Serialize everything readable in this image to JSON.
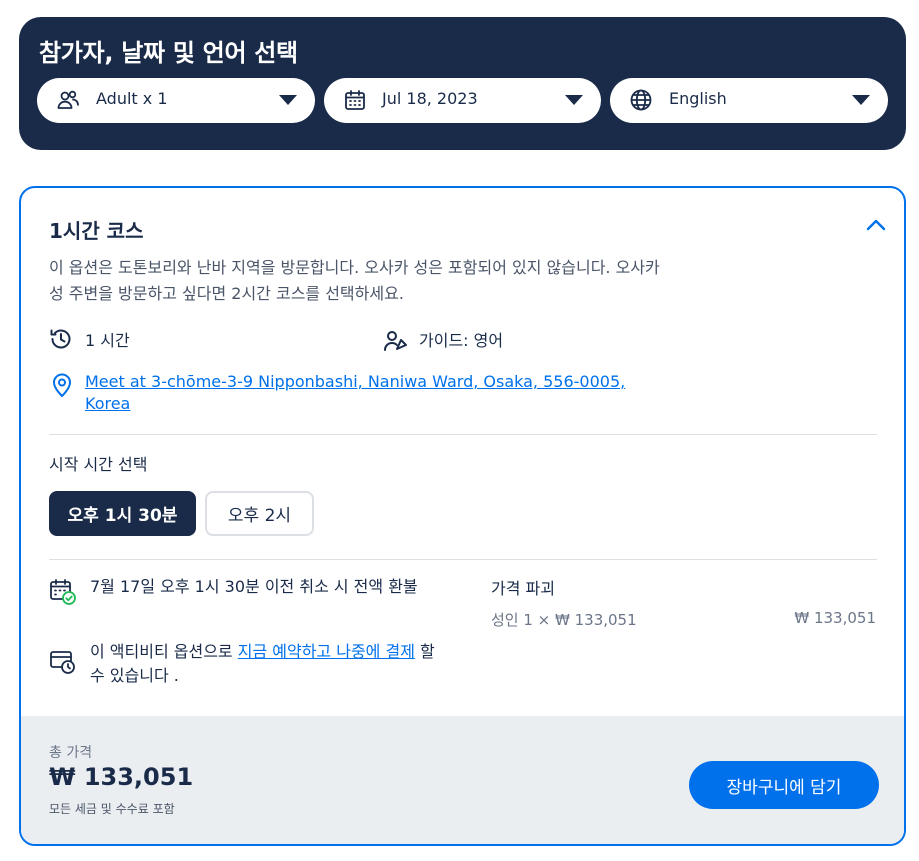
{
  "header": {
    "title": "참가자, 날짜 및 언어 선택",
    "participants": {
      "value": "Adult x 1",
      "icon": "people-icon"
    },
    "date": {
      "value": "Jul 18, 2023",
      "icon": "calendar-icon"
    },
    "language": {
      "value": "English",
      "icon": "globe-icon"
    }
  },
  "option": {
    "title": "1시간 코스",
    "description": "이 옵션은 도톤보리와 난바 지역을 방문합니다. 오사카 성은 포함되어 있지 않습니다. 오사카 성 주변을 방문하고 싶다면 2시간 코스를 선택하세요.",
    "duration": "1 시간",
    "guide": "가이드: 영어",
    "meeting_point": "Meet at 3-chōme-3-9 Nipponbashi, Naniwa Ward, Osaka, 556-0005, Korea",
    "start_time_label": "시작 시간 선택",
    "start_times": [
      "오후 1시 30분",
      "오후 2시"
    ],
    "selected_time_index": 0,
    "cancellation": "7월 17일 오후 1시 30분 이전 취소 시 전액 환불",
    "pay_later_prefix": "이 액티비티 옵션으로 ",
    "pay_later_link": "지금 예약하고 나중에 결제",
    "pay_later_suffix": " 할 수 있습니다 .",
    "price_breakdown_title": "가격 파괴",
    "price_breakdown_line": "성인 1 × ₩ 133,051",
    "price_breakdown_amount": "₩ 133,051"
  },
  "footer": {
    "total_label": "총 가격",
    "total_amount": "₩ 133,051",
    "total_note": "모든 세금 및 수수료 포함",
    "cart_button": "장바구니에 담기"
  },
  "colors": {
    "navy": "#1a2b49",
    "accent_blue": "#0071eb",
    "footer_bg": "#ebeef1",
    "success_green": "#1db954"
  }
}
